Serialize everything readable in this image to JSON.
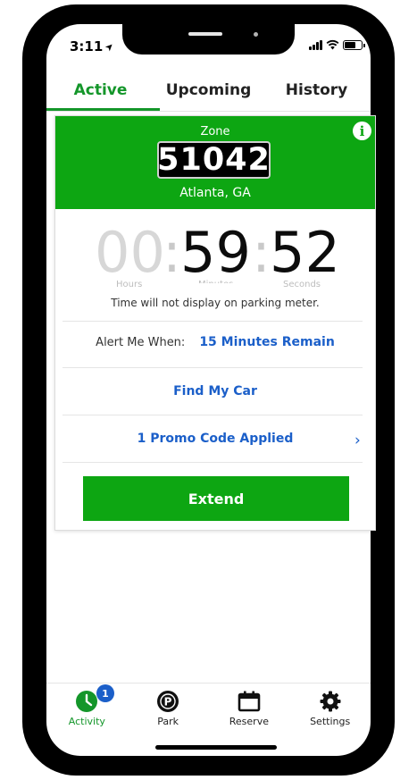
{
  "status_bar": {
    "time": "3:11"
  },
  "tabs": [
    {
      "label": "Active",
      "selected": true
    },
    {
      "label": "Upcoming",
      "selected": false
    },
    {
      "label": "History",
      "selected": false
    }
  ],
  "zone": {
    "label": "Zone",
    "number": "51042",
    "city": "Atlanta, GA",
    "info_icon": "info-icon"
  },
  "timer": {
    "hours": "00",
    "minutes": "59",
    "seconds": "52",
    "hours_label": "Hours",
    "minutes_label": "Minutes",
    "seconds_label": "Seconds",
    "separator": ":"
  },
  "meter_note": "Time will not display on parking meter.",
  "alert": {
    "label": "Alert Me When:",
    "value": "15 Minutes Remain"
  },
  "find_car": "Find My Car",
  "promo": {
    "label": "1 Promo Code Applied",
    "chevron": "›"
  },
  "extend_button": "Extend",
  "bottom_nav": [
    {
      "label": "Activity",
      "icon": "clock-icon",
      "badge": "1",
      "selected": true
    },
    {
      "label": "Park",
      "icon": "parking-icon",
      "selected": false
    },
    {
      "label": "Reserve",
      "icon": "calendar-icon",
      "selected": false
    },
    {
      "label": "Settings",
      "icon": "gear-icon",
      "selected": false
    }
  ],
  "colors": {
    "brand_green": "#0da612",
    "tab_green": "#14962a",
    "link_blue": "#1b5fc9",
    "badge_blue": "#1b5fc9"
  }
}
